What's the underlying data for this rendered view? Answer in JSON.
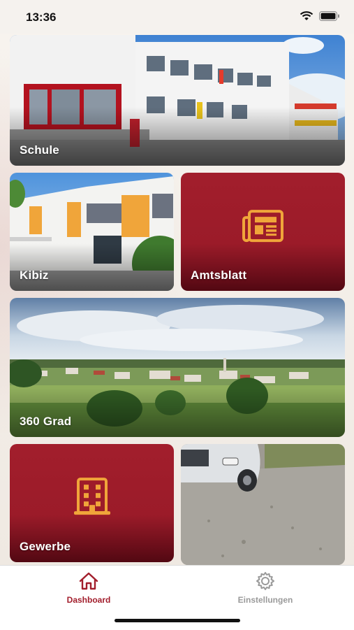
{
  "status_bar": {
    "time": "13:36",
    "icons": [
      "wifi-icon",
      "battery-icon"
    ]
  },
  "tiles": [
    {
      "id": "schule",
      "label": "Schule",
      "kind": "photo"
    },
    {
      "id": "kibiz",
      "label": "Kibiz",
      "kind": "photo"
    },
    {
      "id": "amtsblatt",
      "label": "Amtsblatt",
      "kind": "icon",
      "icon": "newspaper-icon"
    },
    {
      "id": "360grad",
      "label": "360 Grad",
      "kind": "photo"
    },
    {
      "id": "gewerbe",
      "label": "Gewerbe",
      "kind": "icon",
      "icon": "building-icon"
    },
    {
      "id": "road",
      "label": "",
      "kind": "photo"
    }
  ],
  "tab_bar": {
    "items": [
      {
        "label": "Dashboard",
        "icon": "home-icon",
        "active": true
      },
      {
        "label": "Einstellungen",
        "icon": "gear-icon",
        "active": false
      }
    ]
  },
  "colors": {
    "accent_red": "#a21e2c",
    "icon_orange": "#f0a53a",
    "inactive_tab": "#9a9a9a"
  }
}
